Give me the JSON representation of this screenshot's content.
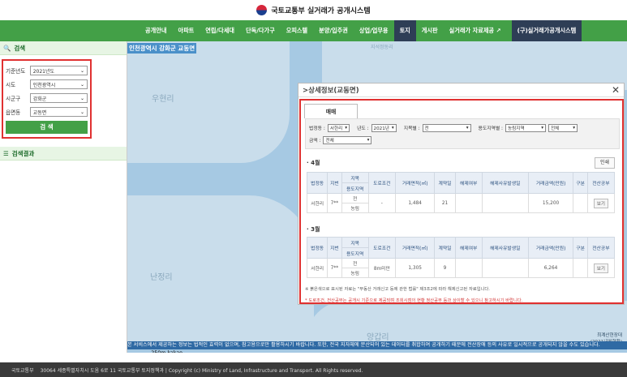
{
  "header": {
    "site_title": "국토교통부 실거래가 공개시스템"
  },
  "nav": {
    "items": [
      "공개안내",
      "아파트",
      "연립/다세대",
      "단독/다가구",
      "오피스텔",
      "분양/입주권",
      "상업/업무용",
      "토지",
      "게시판",
      "실거래가 자료제공 ↗",
      "(구)실거래가공개시스템"
    ],
    "active": "토지"
  },
  "sidebar": {
    "search_title": "검색",
    "results_title": "검색결과",
    "fields": [
      {
        "label": "기준년도",
        "value": "2021년도"
      },
      {
        "label": "시도",
        "value": "인천광역시"
      },
      {
        "label": "시군구",
        "value": "강화군"
      },
      {
        "label": "읍면동",
        "value": "교동면"
      }
    ],
    "search_button": "검 색"
  },
  "map": {
    "region_label": "인천광역시 강화군 교동면",
    "top_label": "지석정동리",
    "places": [
      "우현리",
      "난정리",
      "양갑리"
    ],
    "notice": "본 서비스에서 제공하는 정보는 법적인 효력이 없으며, 참고용으로만 활용하시기 바랍니다. 또한, 전국 지자체에 분산되어 있는 데이터를 취합하여 공개하기 때문에 전산장애 등의 사유로 일시적으로 공개되지 않을 수도 있습니다.",
    "scale": "250m",
    "brand": "kakao",
    "credit_line1": "최계산현장대",
    "credit_line2": "(2021년월현황)"
  },
  "popup": {
    "title": "상세정보(교동면)",
    "tab": "매매",
    "filters": {
      "row1": [
        {
          "label": "법정동 :",
          "value": "서한리"
        },
        {
          "label": "년도 :",
          "value": "2021년"
        },
        {
          "label": "지목별 :",
          "value": "전"
        },
        {
          "label": "용도지역별 :",
          "value": "농림지역"
        },
        {
          "label": "",
          "value": "전체"
        }
      ],
      "row2": [
        {
          "label": "금액 :",
          "value": "전체"
        }
      ]
    },
    "print_button": "인쇄",
    "headers": {
      "dong": "법정동",
      "jibun": "지번",
      "jimok": "지목",
      "use": "용도지역",
      "road": "도로조건",
      "area": "거래면적(㎡)",
      "day": "계약일",
      "cancel": "해제여부",
      "cancel_date": "해제사유발생일",
      "price": "거래금액(만원)",
      "type": "구분",
      "sign": "전산공부"
    },
    "sections": [
      {
        "month": "· 4월",
        "row": {
          "dong": "서한리",
          "jibun": "7**",
          "jimok": "전",
          "use": "농림",
          "road": "-",
          "area": "1,484",
          "day": "21",
          "cancel": "",
          "cancel_date": "",
          "price": "15,200",
          "type": "",
          "view": "보기"
        }
      },
      {
        "month": "· 3월",
        "row": {
          "dong": "서한리",
          "jibun": "7**",
          "jimok": "전",
          "use": "농림",
          "road": "8m미만",
          "area": "1,305",
          "day": "9",
          "cancel": "",
          "cancel_date": "",
          "price": "6,264",
          "type": "",
          "view": "보기"
        }
      }
    ],
    "note1": "※ 붉은색으로 표시된 자료는 \"부동산 거래신고 등에 관한 법률\" 제3조2에 따라 해제신고된 자료입니다.",
    "note2": "* 도로조건, 전산공부는 공개시 기준으로 제공되며 조회시점의 현황 정산공부 등과 상이할 수 있으니 참고하시기 바랍니다."
  },
  "footer": {
    "org": "국토교통부",
    "text": "30064 세종특별자치시 도움 6로 11 국토교통부 토지정책과 | Copyright (c) Ministry of Land, Infrastructure and Transport. All Rights reserved."
  }
}
